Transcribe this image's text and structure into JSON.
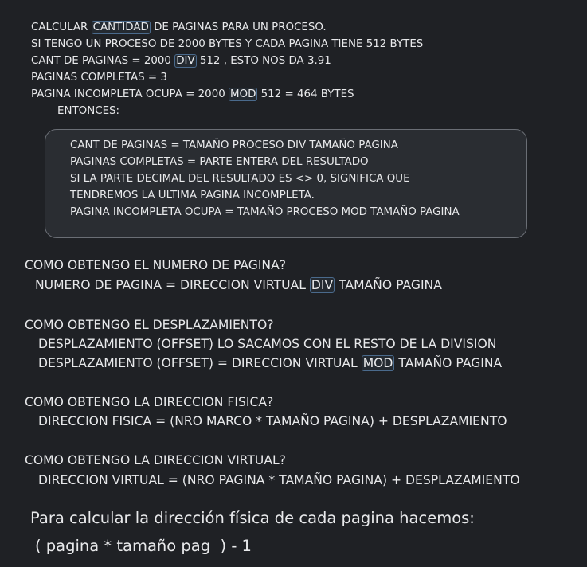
{
  "intro": {
    "l1_pre": "CALCULAR ",
    "l1_hl": "CANTIDAD",
    "l1_post": " DE PAGINAS PARA UN PROCESO.",
    "l2": "SI TENGO UN PROCESO DE 2000 BYTES Y CADA PAGINA TIENE 512 BYTES",
    "l3_pre": "CANT DE PAGINAS = 2000 ",
    "l3_hl": "DIV",
    "l3_post": " 512 , ESTO NOS DA 3.91",
    "l4": "PAGINAS COMPLETAS = 3",
    "l5_pre": "PAGINA INCOMPLETA OCUPA = 2000 ",
    "l5_hl": "MOD",
    "l5_post": " 512 = 464 BYTES",
    "l6": "ENTONCES:"
  },
  "callout": {
    "l1": "CANT DE PAGINAS = TAMAÑO PROCESO DIV TAMAÑO PAGINA",
    "l2": "PAGINAS COMPLETAS = PARTE ENTERA DEL RESULTADO",
    "l3": "SI LA PARTE DECIMAL DEL RESULTADO ES <> 0, SIGNIFICA QUE",
    "l4": "TENDREMOS LA ULTIMA PAGINA INCOMPLETA.",
    "l5": "PAGINA INCOMPLETA OCUPA = TAMAÑO PROCESO MOD TAMAÑO PAGINA"
  },
  "page_number": {
    "question": "COMO OBTENGO EL NUMERO DE PAGINA?",
    "formula_pre": "NUMERO DE PAGINA = DIRECCION VIRTUAL ",
    "formula_hl": "DIV",
    "formula_post": " TAMAÑO PAGINA"
  },
  "offset": {
    "question": "COMO OBTENGO EL DESPLAZAMIENTO?",
    "l1": "DESPLAZAMIENTO (OFFSET) LO SACAMOS CON EL RESTO DE LA DIVISION",
    "l2_pre": "DESPLAZAMIENTO (OFFSET) = DIRECCION VIRTUAL ",
    "l2_hl": "MOD",
    "l2_post": " TAMAÑO PAGINA"
  },
  "physical": {
    "question": "COMO OBTENGO LA DIRECCION FISICA?",
    "formula": "DIRECCION FISICA = (NRO MARCO * TAMAÑO PAGINA) + DESPLAZAMIENTO"
  },
  "virtual": {
    "question": "COMO OBTENGO LA DIRECCION VIRTUAL?",
    "formula": "DIRECCION VIRTUAL = (NRO PAGINA * TAMAÑO PAGINA) + DESPLAZAMIENTO"
  },
  "footer": {
    "l1": "Para calcular la dirección física de cada pagina hacemos:",
    "l2": "( pagina * tamaño pag  ) - 1"
  }
}
